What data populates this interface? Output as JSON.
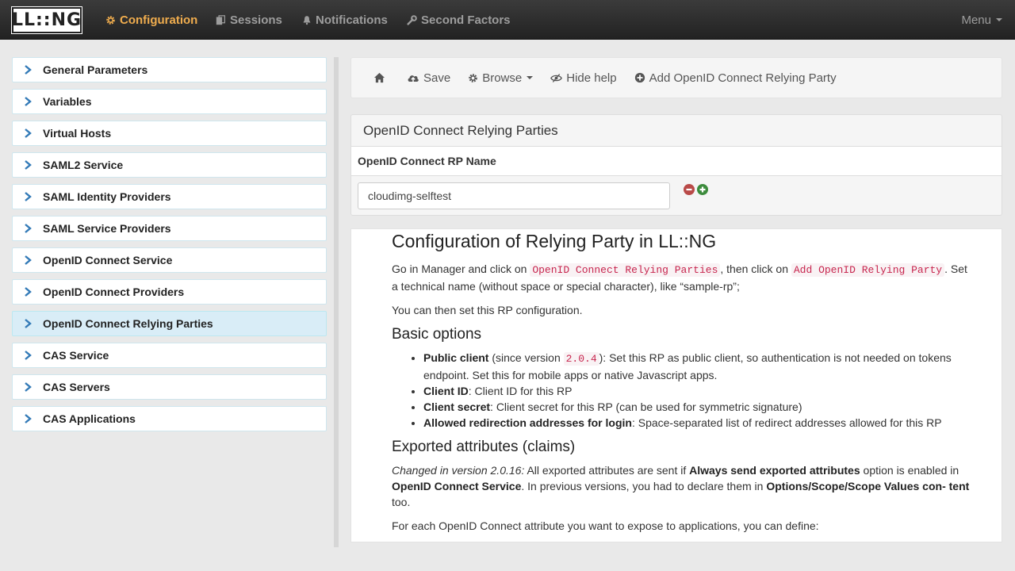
{
  "app": {
    "logo_text": "LL::NG"
  },
  "nav": {
    "items": [
      {
        "label": "Configuration",
        "icon": "gear-icon",
        "active": true
      },
      {
        "label": "Sessions",
        "icon": "copy-icon",
        "active": false
      },
      {
        "label": "Notifications",
        "icon": "bell-icon",
        "active": false
      },
      {
        "label": "Second Factors",
        "icon": "wrench-icon",
        "active": false
      }
    ],
    "menu_label": "Menu"
  },
  "sidebar": {
    "items": [
      {
        "label": "General Parameters"
      },
      {
        "label": "Variables"
      },
      {
        "label": "Virtual Hosts"
      },
      {
        "label": "SAML2 Service"
      },
      {
        "label": "SAML Identity Providers"
      },
      {
        "label": "SAML Service Providers"
      },
      {
        "label": "OpenID Connect Service"
      },
      {
        "label": "OpenID Connect Providers"
      },
      {
        "label": "OpenID Connect Relying Parties",
        "selected": true
      },
      {
        "label": "CAS Service"
      },
      {
        "label": "CAS Servers"
      },
      {
        "label": "CAS Applications"
      }
    ]
  },
  "toolbar": {
    "save_label": "Save",
    "browse_label": "Browse",
    "hide_help_label": "Hide help",
    "add_rp_label": "Add OpenID Connect Relying Party"
  },
  "panel": {
    "title": "OpenID Connect Relying Parties",
    "column_header": "OpenID Connect RP Name",
    "rp_name_value": "cloudimg-selftest"
  },
  "help": {
    "title": "Configuration of Relying Party in LL::NG",
    "intro_1": "Go in Manager and click on ",
    "intro_code_1": "OpenID Connect Relying Parties",
    "intro_2": ", then click on ",
    "intro_code_2": "Add OpenID Relying Party",
    "intro_3": ". Set a technical name (without space or special character), like “sample-rp”;",
    "intro_then": "You can then set this RP configuration.",
    "basic_title": "Basic options",
    "basic": {
      "public_client_label": "Public client",
      "public_client_pre": " (since version ",
      "public_client_version": "2.0.4",
      "public_client_desc": "): Set this RP as public client, so authentication is not needed on tokens endpoint. Set this for mobile apps or native Javascript apps.",
      "client_id_label": "Client ID",
      "client_id_desc": ": Client ID for this RP",
      "client_secret_label": "Client secret",
      "client_secret_desc": ": Client secret for this RP (can be used for symmetric signature)",
      "redirect_label": "Allowed redirection addresses for login",
      "redirect_desc": ": Space-separated list of redirect addresses allowed for this RP"
    },
    "exported_title": "Exported attributes (claims)",
    "exported": {
      "changed_label": "Changed in version 2.0.16:",
      "text_1": " All exported attributes are sent if ",
      "always_send": "Always send exported attributes",
      "text_2": " option is enabled in ",
      "oidc_service": "OpenID Connect Service",
      "text_3": ". In previous versions, you had to declare them in ",
      "scope_values": "Options/Scope/Scope Values con- tent",
      "text_4": " too."
    },
    "for_each": "For each OpenID Connect attribute you want to expose to applications, you can define:"
  },
  "colors": {
    "accent": "#f0ad4e",
    "chevron": "#337ab7",
    "selected_bg": "#d9edf7",
    "remove": "#b94a48",
    "add": "#3c8b3c"
  }
}
